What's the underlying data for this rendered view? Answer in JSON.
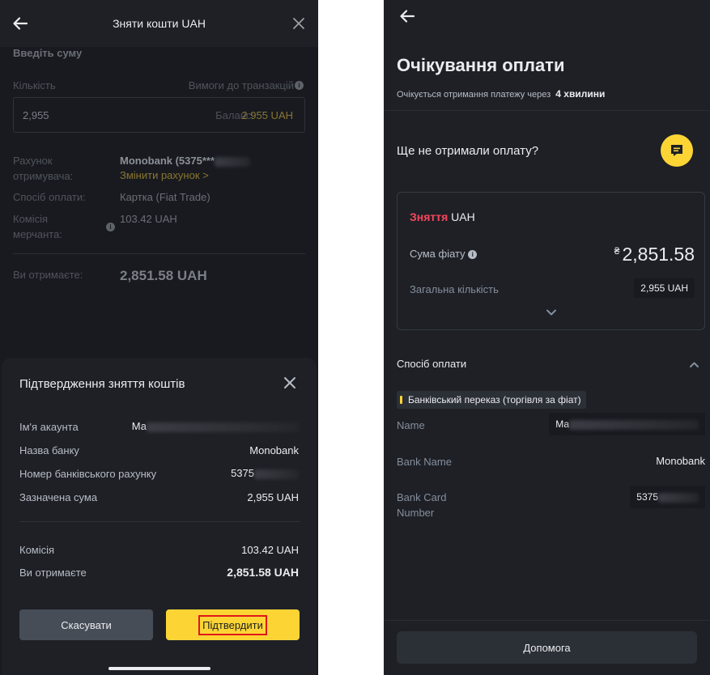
{
  "left": {
    "topbar": {
      "title": "Зняти кошти UAH"
    },
    "form": {
      "section_label": "Введіть суму",
      "amount_label": "Кількість",
      "requirements_label": "Вимоги до транзакцій",
      "amount_value": "2,955",
      "balance_label": "Баланс:",
      "balance_value": "2 955 UAH",
      "recipient_label": "Рахунок отримувача:",
      "recipient_value": "Monobank (5375***",
      "change_account": "Змінити рахунок >",
      "payment_method_label": "Спосіб оплати:",
      "payment_method_value": "Картка (Fiat Trade)",
      "merchant_fee_label": "Комісія мерчанта:",
      "merchant_fee_value": "103.42 UAH",
      "receive_label": "Ви отримаєте:",
      "receive_value": "2,851.58 UAH"
    },
    "sheet": {
      "title": "Підтвердження зняття коштів",
      "rows": [
        {
          "label": "Ім'я акаунта",
          "value": "Ма"
        },
        {
          "label": "Назва банку",
          "value": "Monobank"
        },
        {
          "label": "Номер банківського рахунку",
          "value": "5375"
        },
        {
          "label": "Зазначена сума",
          "value": "2,955 UAH"
        }
      ],
      "fee_label": "Комісія",
      "fee_value": "103.42 UAH",
      "receive_label": "Ви отримаєте",
      "receive_value": "2,851.58 UAH",
      "cancel_label": "Скасувати",
      "confirm_label": "Підтвердити"
    }
  },
  "right": {
    "title": "Очікування оплати",
    "subtitle": "Очікується отримання платежу через",
    "subtitle_time": "4 хвилини",
    "question": "Ще не отримали оплату?",
    "card": {
      "title_red": "Зняття",
      "title_rest": "UAH",
      "fiat_label": "Сума фіату",
      "fiat_currency": "₴",
      "fiat_value": "2,851.58",
      "total_label": "Загальна кількість",
      "total_value": "2,955 UAH"
    },
    "payment_section": "Спосіб оплати",
    "payment_badge": "Банківський переказ (торгівля за фіат)",
    "fields": {
      "name_label": "Name",
      "name_value": "Ма",
      "bank_label": "Bank Name",
      "bank_value": "Monobank",
      "card_label": "Bank Card Number",
      "card_value": "5375"
    },
    "help_label": "Допомога"
  },
  "colors": {
    "accent": "#fcd535",
    "negative": "#f6465d",
    "background_dark": "#181a20",
    "panel": "#1e2026",
    "highlight_box": "#e0161b"
  }
}
